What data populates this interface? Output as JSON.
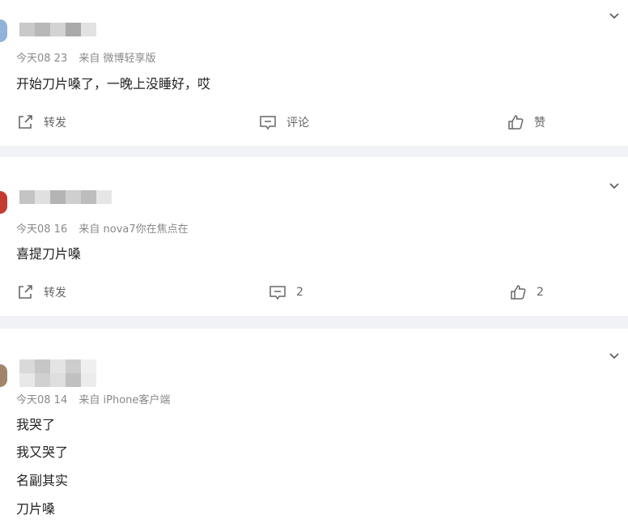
{
  "posts": [
    {
      "time": "今天08 23",
      "source_prefix": "来自",
      "source": "微博轻享版",
      "lines": [
        "开始刀片嗓了，一晚上没睡好，哎"
      ],
      "repost_label": "转发",
      "comment_label": "评论",
      "like_label": "赞"
    },
    {
      "time": "今天08 16",
      "source_prefix": "来自",
      "source": "nova7你在焦点在",
      "lines": [
        "喜提刀片嗓"
      ],
      "repost_label": "转发",
      "comment_label": "2",
      "like_label": "2"
    },
    {
      "time": "今天08 14",
      "source_prefix": "来自",
      "source": "iPhone客户端",
      "lines": [
        "我哭了",
        "我又哭了",
        "名副其实",
        "刀片嗓"
      ]
    }
  ],
  "icons": {
    "repost": "repost-icon",
    "comment": "comment-icon",
    "like": "thumbs-up-icon",
    "expand": "chevron-down-icon"
  },
  "colors": {
    "background": "#f1f2f5",
    "card": "#ffffff",
    "meta_text": "#888888",
    "body_text": "#222222"
  }
}
